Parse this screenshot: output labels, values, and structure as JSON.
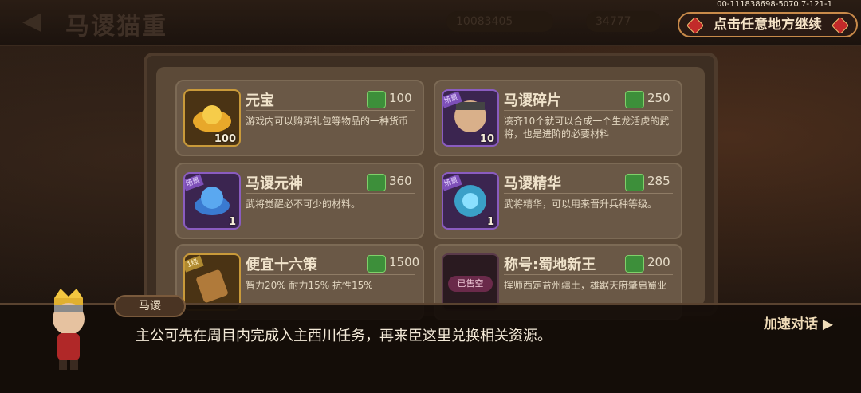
{
  "build_id": "00-111838698-5070.7-121-1",
  "header": {
    "title": "马谡猫重",
    "resource_1": "10083405",
    "resource_2": "34777"
  },
  "continue_button": "点击任意地方继续",
  "items": [
    {
      "name": "元宝",
      "price": "100",
      "qty": "100",
      "desc": "游戏内可以购买礼包等物品的一种货币",
      "tag": ""
    },
    {
      "name": "马谡碎片",
      "price": "250",
      "qty": "10",
      "desc": "凑齐10个就可以合成一个生龙活虎的武将，也是进阶的必要材料",
      "tag": "场景"
    },
    {
      "name": "马谡元神",
      "price": "360",
      "qty": "1",
      "desc": "武将觉醒必不可少的材料。",
      "tag": "场景"
    },
    {
      "name": "马谡精华",
      "price": "285",
      "qty": "1",
      "desc": "武将精华，可以用来晋升兵种等级。",
      "tag": "场景"
    },
    {
      "name": "便宜十六策",
      "price": "1500",
      "qty": "",
      "desc": "智力20%  耐力15%  抗性15%",
      "tag": "1级"
    },
    {
      "name": "称号:蜀地新王",
      "price": "200",
      "qty": "",
      "desc": "挥师西定益州疆土，雄踞天府肇启蜀业",
      "tag": "已售空"
    }
  ],
  "dialog": {
    "speaker": "马谡",
    "text": "主公可先在周目内完成入主西川任务，再来臣这里兑换相关资源。",
    "speed_button": "加速对话"
  },
  "icons": [
    "back-arrow-icon",
    "jade-price-icon",
    "gem-icon",
    "chevron-right-icon"
  ]
}
